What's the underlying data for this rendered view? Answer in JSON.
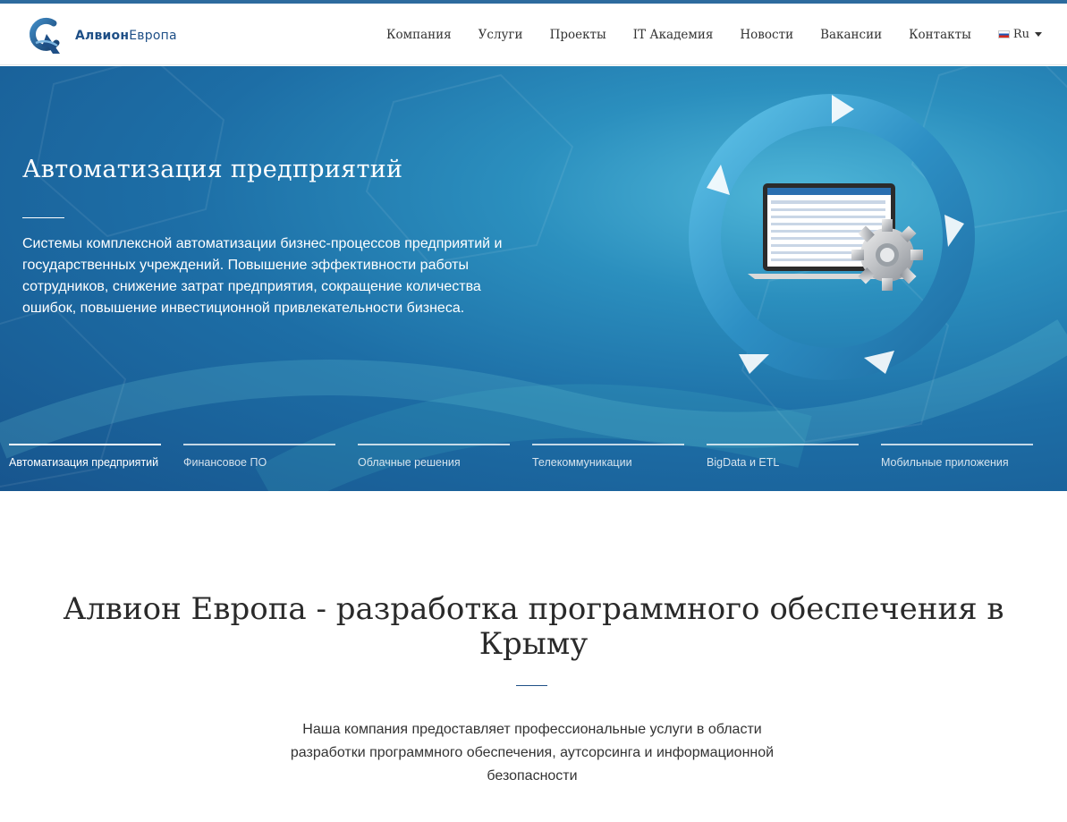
{
  "brand": {
    "name_part1": "Алвион",
    "name_part2": "Европа",
    "primary_color": "#1e4f86",
    "accent_color": "#2d6b9e"
  },
  "nav": {
    "items": [
      {
        "label": "Компания"
      },
      {
        "label": "Услуги"
      },
      {
        "label": "Проекты"
      },
      {
        "label": "IT Академия"
      },
      {
        "label": "Новости"
      },
      {
        "label": "Вакансии"
      },
      {
        "label": "Контакты"
      }
    ],
    "language": {
      "label": "Ru",
      "flag_icon": "russia-flag-icon",
      "caret_icon": "caret-down-icon"
    }
  },
  "hero": {
    "title": "Автоматизация предприятий",
    "description": "Системы комплексной автоматизации бизнес-процессов предприятий и государственных учреждений. Повышение эффективности работы сотрудников, снижение затрат предприятия, сокращение количества ошибок, повышение инвестиционной привлекательности бизнеса.",
    "illustration_icon": "laptop-gear-cycle-icon",
    "background_color": "#1d6ea6",
    "tabs": [
      {
        "label": "Автоматизация предприятий",
        "active": true
      },
      {
        "label": "Финансовое ПО",
        "active": false
      },
      {
        "label": "Облачные решения",
        "active": false
      },
      {
        "label": "Телекоммуникации",
        "active": false
      },
      {
        "label": "BigData и ETL",
        "active": false
      },
      {
        "label": "Мобильные приложения",
        "active": false
      }
    ]
  },
  "about": {
    "title": "Алвион Европа - разработка программного обеспечения в Крыму",
    "description": "Наша компания предоставляет профессиональные услуги в области разработки программного обеспечения, аутсорсинга и информационной безопасности"
  }
}
